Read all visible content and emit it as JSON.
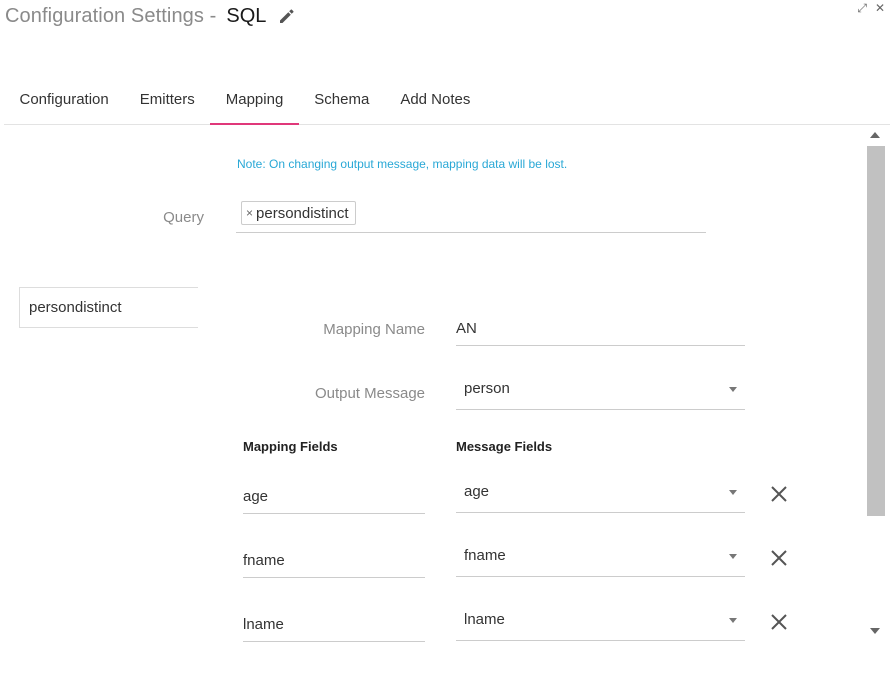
{
  "header": {
    "title_prefix": "Configuration Settings -",
    "title_name": "SQL"
  },
  "window_controls": {
    "expand_glyph": "⤢",
    "close_glyph": "✕"
  },
  "tabs": [
    {
      "label": "Configuration",
      "active": false
    },
    {
      "label": "Emitters",
      "active": false
    },
    {
      "label": "Mapping",
      "active": true
    },
    {
      "label": "Schema",
      "active": false
    },
    {
      "label": "Add Notes",
      "active": false
    }
  ],
  "note": "Note: On changing output message, mapping data will be lost.",
  "query": {
    "label": "Query",
    "chips": [
      {
        "label": "persondistinct",
        "remove_glyph": "×"
      }
    ]
  },
  "side_list": {
    "items": [
      {
        "label": "persondistinct"
      }
    ]
  },
  "mapping_form": {
    "mapping_name_label": "Mapping Name",
    "mapping_name_value": "AN",
    "output_message_label": "Output Message",
    "output_message_value": "person",
    "mapping_fields_header": "Mapping Fields",
    "message_fields_header": "Message Fields",
    "rows": [
      {
        "mapping_field": "age",
        "message_field": "age"
      },
      {
        "mapping_field": "fname",
        "message_field": "fname"
      },
      {
        "mapping_field": "lname",
        "message_field": "lname"
      }
    ]
  },
  "colors": {
    "accent_tab_underline": "#e0387a",
    "note_text": "#29a8d6",
    "label_gray": "#8a8a8a"
  },
  "icons": {
    "edit": "pencil-icon",
    "remove": "close-icon",
    "dropdown": "caret-down-icon"
  }
}
